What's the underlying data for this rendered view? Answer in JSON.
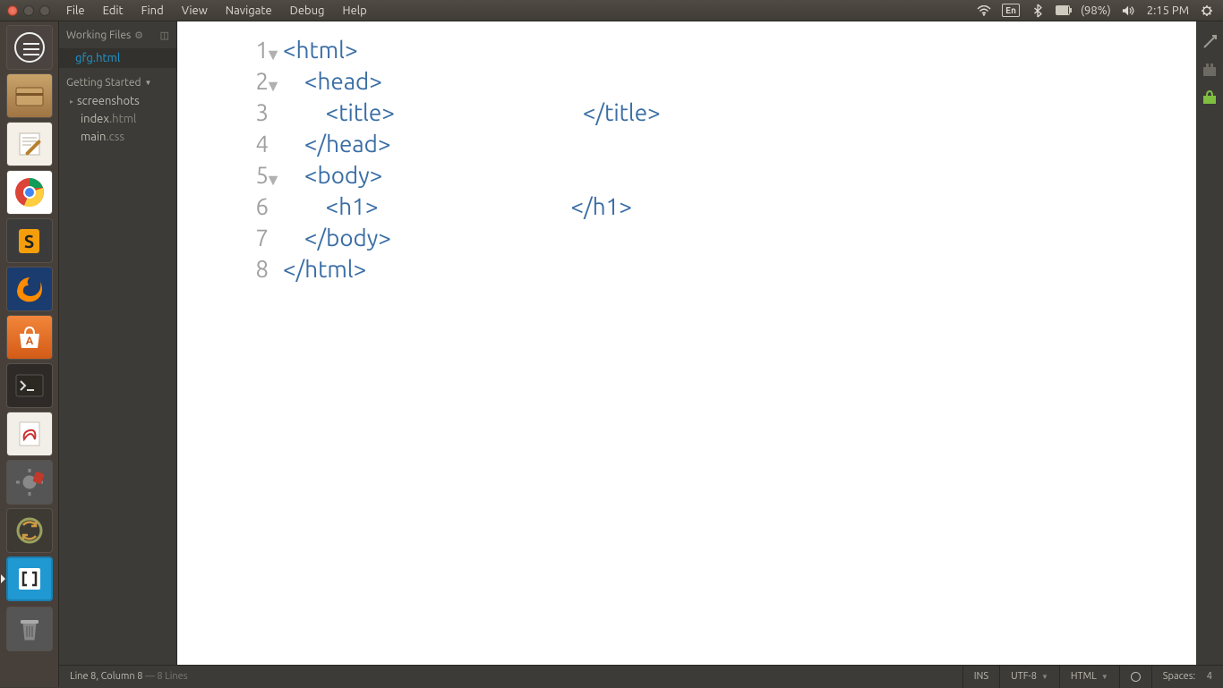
{
  "menubar": [
    "File",
    "Edit",
    "Find",
    "View",
    "Navigate",
    "Debug",
    "Help"
  ],
  "tray": {
    "lang": "En",
    "battery": "(98%)",
    "time": "2:15 PM"
  },
  "sidebar": {
    "working_header": "Working Files",
    "working_file": "gfg.html",
    "getting_started": "Getting Started",
    "folder": "screenshots",
    "files": [
      {
        "name": "index",
        "ext": ".html"
      },
      {
        "name": "main",
        "ext": ".css"
      }
    ]
  },
  "code": {
    "lines": [
      {
        "n": "1",
        "fold": true,
        "indent": 0,
        "open": "<html>",
        "blank": 0,
        "close": ""
      },
      {
        "n": "2",
        "fold": true,
        "indent": 1,
        "open": "<head>",
        "blank": 0,
        "close": ""
      },
      {
        "n": "3",
        "fold": false,
        "indent": 2,
        "open": "<title>",
        "blank": 210,
        "close": "</title>"
      },
      {
        "n": "4",
        "fold": false,
        "indent": 1,
        "open": "</head>",
        "blank": 0,
        "close": ""
      },
      {
        "n": "5",
        "fold": true,
        "indent": 1,
        "open": "<body>",
        "blank": 0,
        "close": ""
      },
      {
        "n": "6",
        "fold": false,
        "indent": 2,
        "open": "<h1>",
        "blank": 215,
        "close": "</h1>"
      },
      {
        "n": "7",
        "fold": false,
        "indent": 1,
        "open": "</body>",
        "blank": 0,
        "close": ""
      },
      {
        "n": "8",
        "fold": false,
        "indent": 0,
        "open": "</html>",
        "blank": 0,
        "close": ""
      }
    ]
  },
  "status": {
    "pos": "Line 8, Column 8",
    "total": " — 8 Lines",
    "ins": "INS",
    "enc": "UTF-8",
    "lang": "HTML",
    "spaces_label": "Spaces:",
    "spaces_val": "4"
  }
}
